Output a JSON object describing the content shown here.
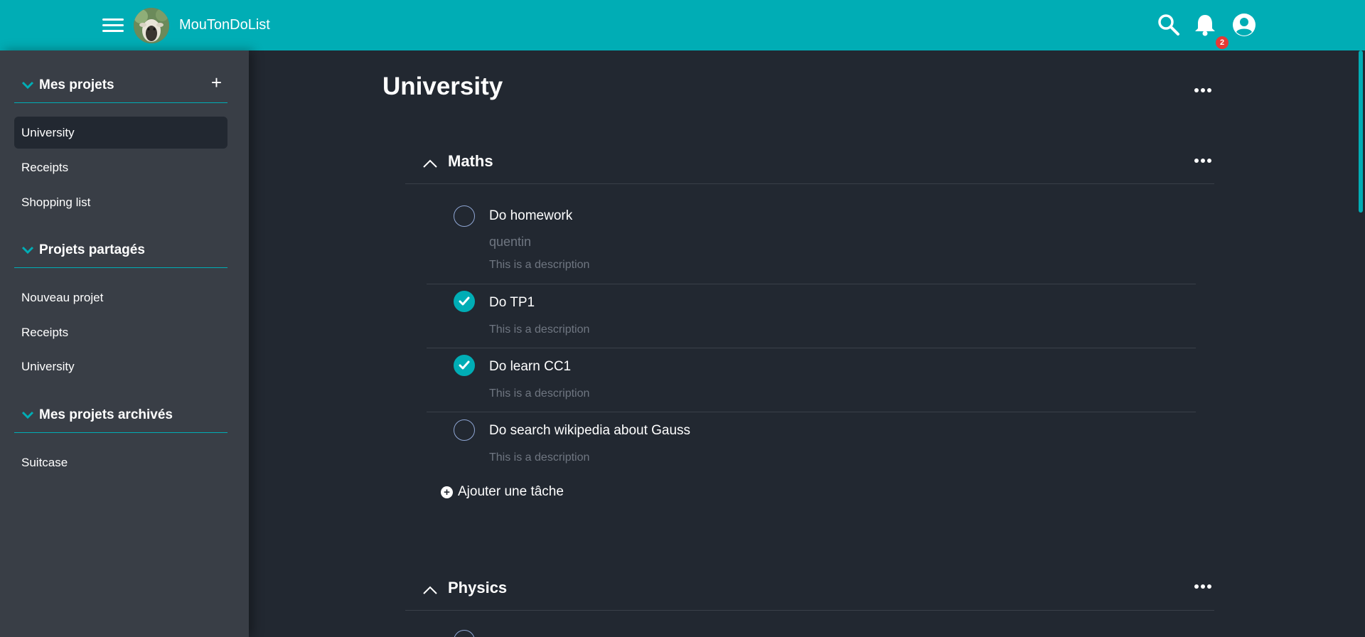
{
  "header": {
    "app_title": "MouTonDoList",
    "notification_count": "2"
  },
  "sidebar": {
    "my_projects": {
      "title": "Mes projets",
      "items": [
        {
          "label": "University",
          "active": true
        },
        {
          "label": "Receipts",
          "active": false
        },
        {
          "label": "Shopping list",
          "active": false
        }
      ]
    },
    "shared_projects": {
      "title": "Projets partagés",
      "items": [
        {
          "label": "Nouveau projet"
        },
        {
          "label": "Receipts"
        },
        {
          "label": "University"
        }
      ]
    },
    "archived_projects": {
      "title": "Mes projets archivés",
      "items": [
        {
          "label": "Suitcase"
        }
      ]
    }
  },
  "main": {
    "page_title": "University",
    "groups": [
      {
        "name": "Maths",
        "tasks": [
          {
            "title": "Do homework",
            "assignee": "quentin",
            "description": "This is a description",
            "done": false
          },
          {
            "title": "Do TP1",
            "description": "This is a description",
            "done": true
          },
          {
            "title": "Do learn CC1",
            "description": "This is a description",
            "done": true
          },
          {
            "title": "Do search wikipedia about Gauss",
            "description": "This is a description",
            "done": false
          }
        ],
        "add_task_label": "Ajouter une tâche"
      },
      {
        "name": "Physics"
      }
    ]
  },
  "colors": {
    "accent": "#00adb5",
    "background": "#222831",
    "sidebar": "#393e46",
    "muted_text": "#6f7681",
    "badge": "#e53935"
  }
}
